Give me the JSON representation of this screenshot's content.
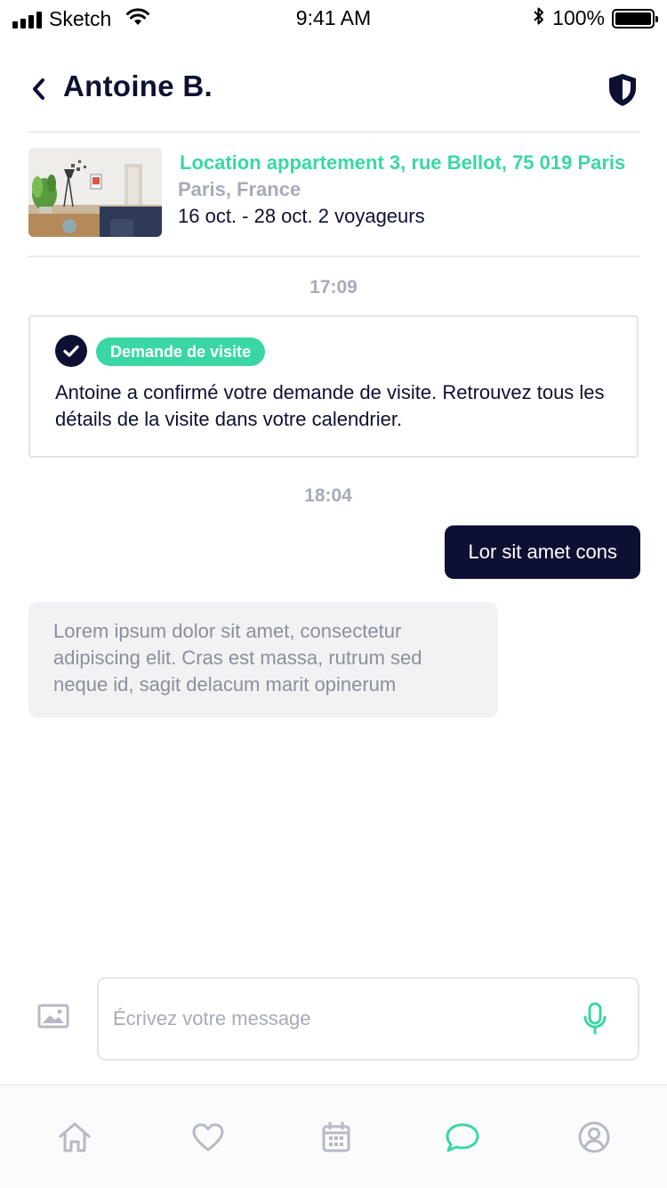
{
  "status_bar": {
    "carrier": "Sketch",
    "time": "9:41 AM",
    "battery": "100%",
    "battery_level": 1.0
  },
  "header": {
    "contact_name": "Antoine B.",
    "back_icon": "chevron-left-icon",
    "shield_icon": "shield-icon"
  },
  "listing": {
    "title": "Location appartement 3, rue Bellot, 75 019 Paris",
    "location": "Paris, France",
    "dates": "16 oct. - 28 oct. 2 voyageurs"
  },
  "conversation": {
    "time_1": "17:09",
    "notification": {
      "badge": "Demande de visite",
      "text": "Antoine a confirmé votre demande de visite. Retrouvez tous les détails de la visite dans votre calendrier."
    },
    "time_2": "18:04",
    "outgoing_message": "Lor sit amet cons",
    "incoming_message": "Lorem ipsum dolor sit amet, consectetur adipiscing elit. Cras est massa, rutrum sed neque id, sagit delacum marit opinerum"
  },
  "composer": {
    "placeholder": "Écrivez votre message",
    "message_value": ""
  },
  "tab_bar": {
    "tabs": [
      {
        "icon": "home-icon",
        "active": false
      },
      {
        "icon": "heart-icon",
        "active": false
      },
      {
        "icon": "calendar-icon",
        "active": false
      },
      {
        "icon": "chat-icon",
        "active": true
      },
      {
        "icon": "profile-icon",
        "active": false
      }
    ]
  },
  "colors": {
    "navy": "#0d1033",
    "accent": "#3ad6a6",
    "muted": "#a9aab8",
    "bubble_in_bg": "#f2f2f4",
    "icon_inactive": "#b8b9c6"
  }
}
